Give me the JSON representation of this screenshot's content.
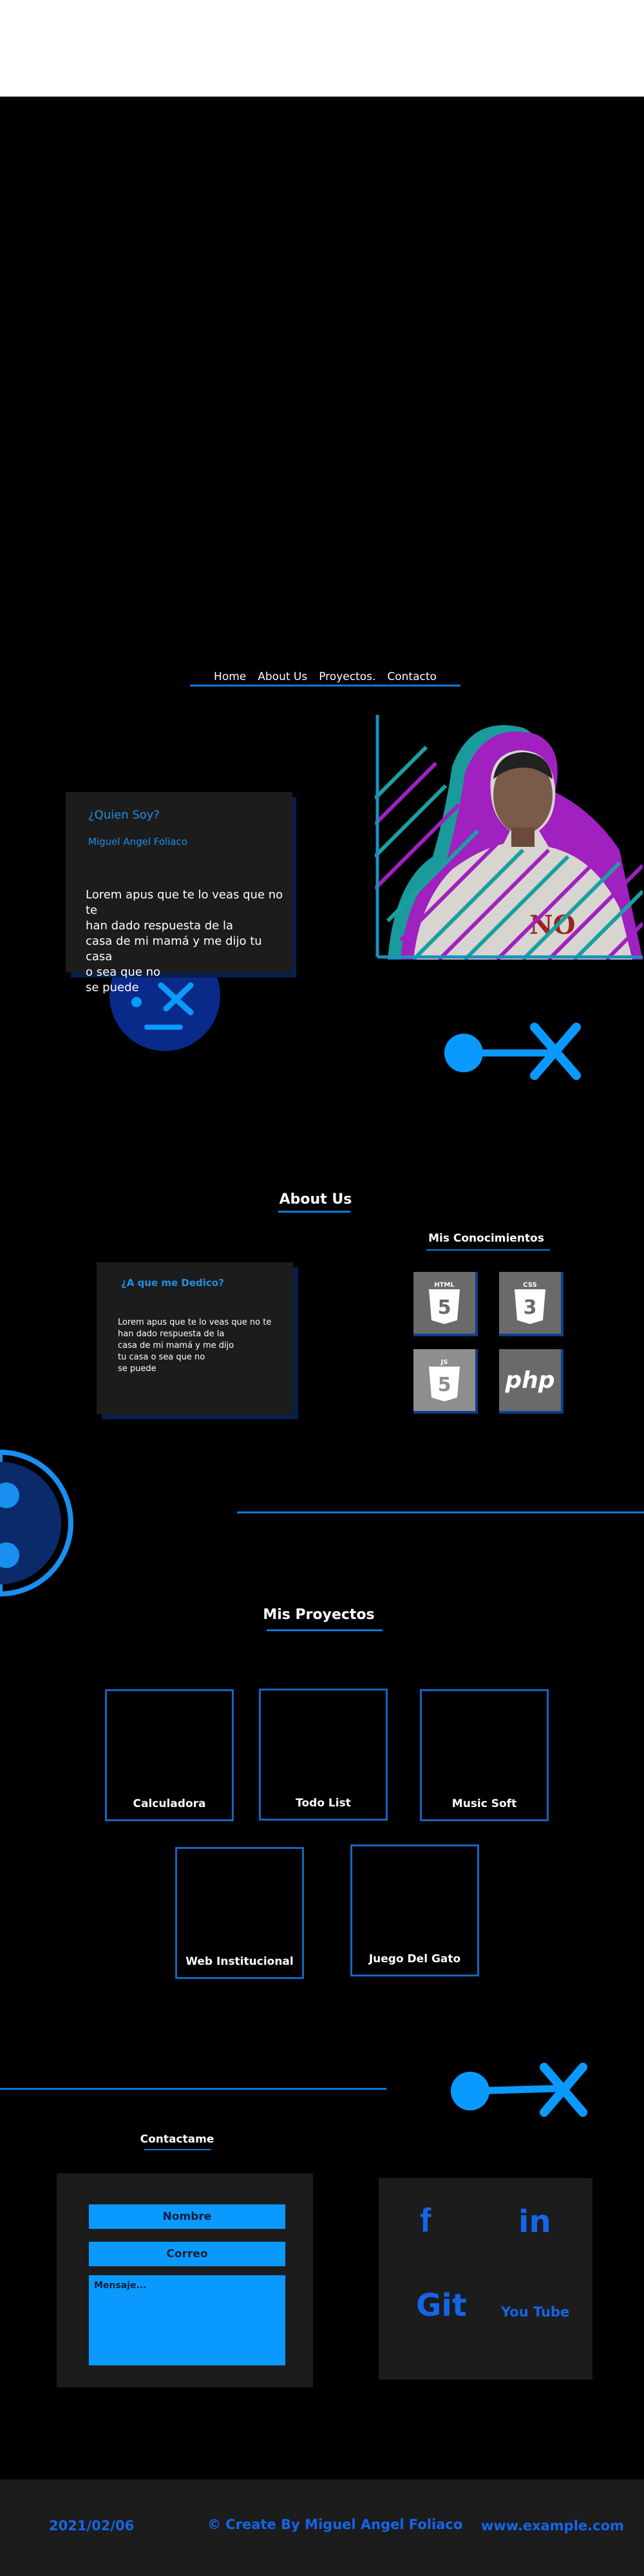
{
  "nav": {
    "items": [
      "Home",
      "About Us",
      "Proyectos.",
      "Contacto"
    ]
  },
  "hero": {
    "heading": "¿Quien Soy?",
    "name": "Miguel Angel Foliaco",
    "text": "Lorem apus que te lo veas que no te\n han dado respuesta de la\ncasa de mi mamá y me dijo tu casa\n o sea que no\n se puede"
  },
  "about": {
    "title": "About Us",
    "card_heading": "¿A que me Dedico?",
    "card_text": "Lorem apus que te lo veas que no te\n  han dado respuesta de la\n  casa de mi mamá y me dijo\n  tu casa o sea que no\n  se puede",
    "knowledge_title": "Mis Conocimientos",
    "tech": [
      {
        "label": "HTML",
        "icon": "html5-icon"
      },
      {
        "label": "CSS",
        "icon": "css3-icon"
      },
      {
        "label": "JS",
        "icon": "js-icon"
      },
      {
        "label": "php",
        "icon": "php-icon"
      }
    ]
  },
  "projects": {
    "title": "Mis Proyectos",
    "items": [
      "Calculadora",
      "Todo List",
      "Music Soft",
      "Web Institucional",
      "Juego Del Gato"
    ]
  },
  "contact": {
    "title": "Contactame",
    "name_placeholder": "Nombre",
    "email_placeholder": "Correo",
    "message_placeholder": "Mensaje...",
    "social": [
      "f",
      "in",
      "Git",
      "You Tube"
    ]
  },
  "footer": {
    "date": "2021/02/06",
    "credit": "© Create By Miguel Angel Foliaco",
    "site": "www.example.com"
  },
  "colors": {
    "accent": "#0a7bd9",
    "field": "#0a9aff",
    "card": "#1c1c1c",
    "social": "#1565e8"
  }
}
